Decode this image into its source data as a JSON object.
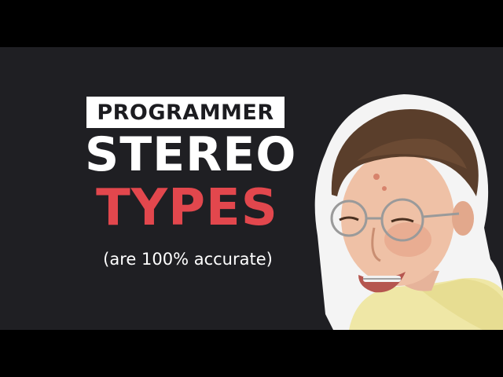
{
  "thumbnail": {
    "label": "PROGRAMMER",
    "line1": "STEREO",
    "line2": "TYPES",
    "subtitle": "(are 100% accurate)"
  },
  "colors": {
    "background": "#1f1f23",
    "accent": "#e2474d",
    "label_bg": "#ffffff",
    "label_text": "#1c1c20"
  },
  "photo": {
    "description_icon": "person-photo"
  }
}
